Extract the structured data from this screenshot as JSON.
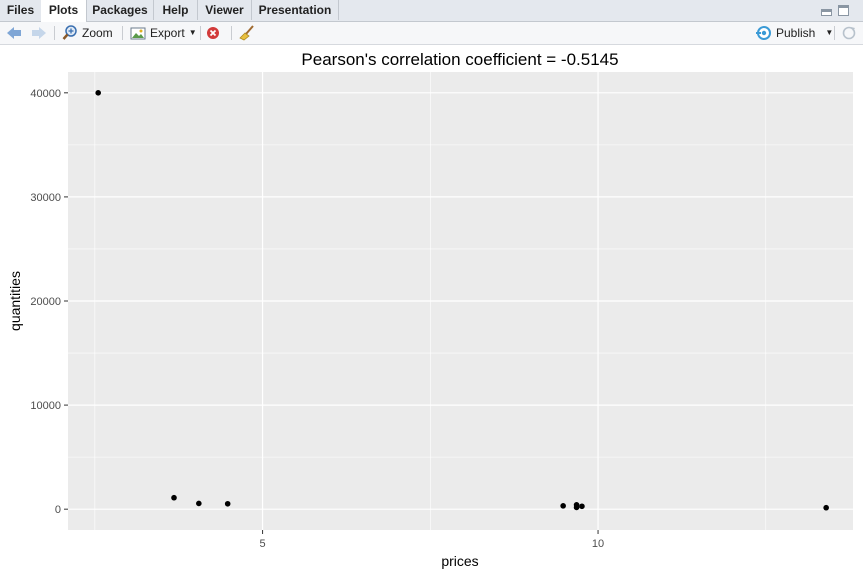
{
  "tabs": [
    "Files",
    "Plots",
    "Packages",
    "Help",
    "Viewer",
    "Presentation"
  ],
  "active_tab": "Plots",
  "toolbar": {
    "zoom_label": "Zoom",
    "export_label": "Export",
    "publish_label": "Publish"
  },
  "chart_data": {
    "type": "scatter",
    "title": "Pearson's correlation coefficient =  -0.5145",
    "xlabel": "prices",
    "ylabel": "quantities",
    "xlim": [
      2.1,
      13.8
    ],
    "ylim": [
      -2000,
      42000
    ],
    "xticks": [
      5,
      10
    ],
    "xtick_labels": [
      "5",
      "10"
    ],
    "yticks": [
      0,
      10000,
      20000,
      30000,
      40000
    ],
    "ytick_labels": [
      "0",
      "10000",
      "20000",
      "30000",
      "40000"
    ],
    "grid": true,
    "points": [
      {
        "x": 2.55,
        "y": 40000
      },
      {
        "x": 3.68,
        "y": 1100
      },
      {
        "x": 4.05,
        "y": 550
      },
      {
        "x": 4.48,
        "y": 520
      },
      {
        "x": 9.48,
        "y": 320
      },
      {
        "x": 9.68,
        "y": 420
      },
      {
        "x": 9.68,
        "y": 170
      },
      {
        "x": 9.76,
        "y": 280
      },
      {
        "x": 13.4,
        "y": 140
      }
    ],
    "colors": {
      "panel": "#ebebeb",
      "grid": "#ffffff",
      "point": "#000000"
    }
  }
}
